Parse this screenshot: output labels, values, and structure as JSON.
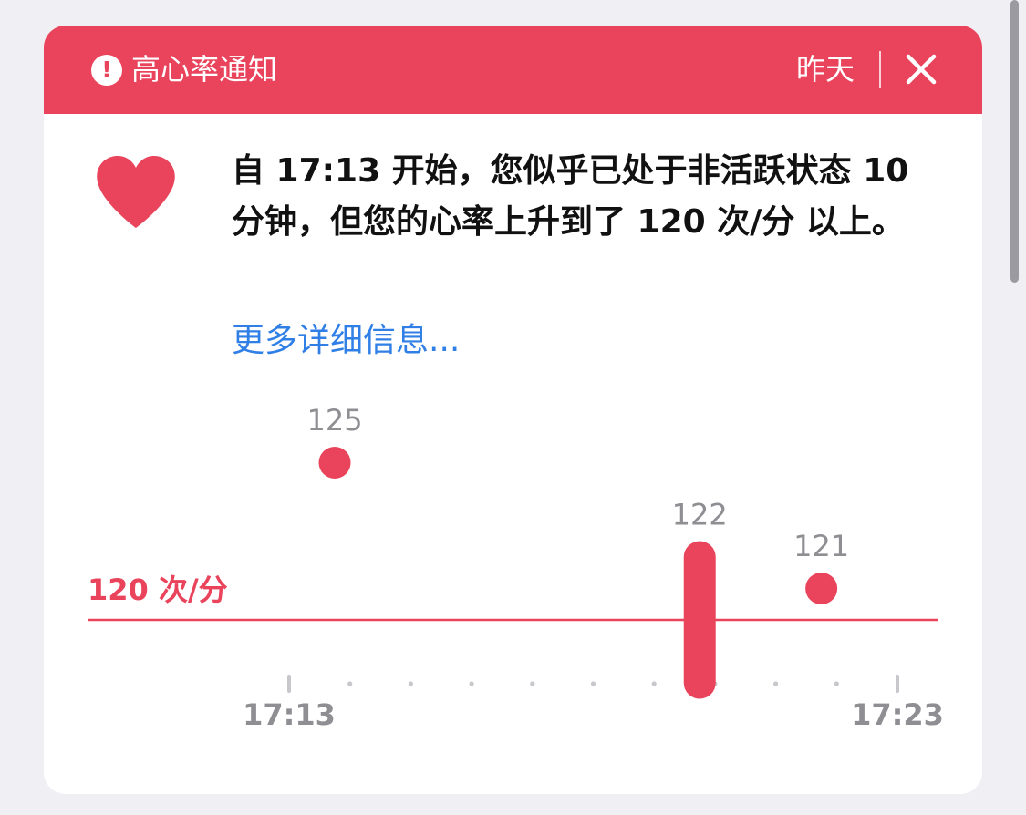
{
  "header": {
    "title": "高心率通知",
    "time": "昨天",
    "alert_icon": "exclamation-circle-icon",
    "close_icon": "close-icon"
  },
  "body": {
    "icon": "heart-icon",
    "message": "自 17:13 开始，您似乎已处于非活跃状态 10 分钟，但您的心率上升到了 120 次/分 以上。",
    "more_link": "更多详细信息..."
  },
  "colors": {
    "accent": "#e9445c",
    "link": "#2f7fe6",
    "muted_text": "#8e8e93"
  },
  "chart_data": {
    "type": "scatter",
    "title": "",
    "x_start_label": "17:13",
    "x_end_label": "17:23",
    "xlim": [
      0,
      10
    ],
    "threshold": {
      "value": 120,
      "label": "120 次/分"
    },
    "points": [
      {
        "x": 0.75,
        "y_min": 125,
        "y_max": 125,
        "label": "125"
      },
      {
        "x": 6.75,
        "y_min": 118,
        "y_max": 122,
        "label": "122"
      },
      {
        "x": 8.75,
        "y_min": 121,
        "y_max": 121,
        "label": "121"
      }
    ]
  }
}
